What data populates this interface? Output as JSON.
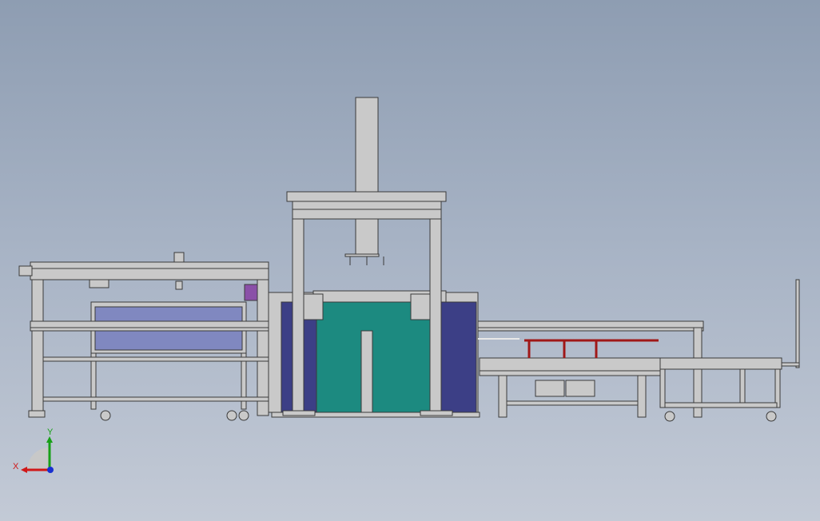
{
  "colors": {
    "frame": "#c9c9c9",
    "frame_stroke": "#3a3a3a",
    "tank_teal": "#1c8a80",
    "tank_navy": "#3c3f86",
    "window_blue": "#8088c0",
    "red_rack": "#a01818",
    "purple_part": "#8a50a8",
    "axis_x": "#d01818",
    "axis_y": "#18a018",
    "axis_z": "#1830d0"
  },
  "triad": {
    "x_label": "X",
    "y_label": "Y"
  }
}
